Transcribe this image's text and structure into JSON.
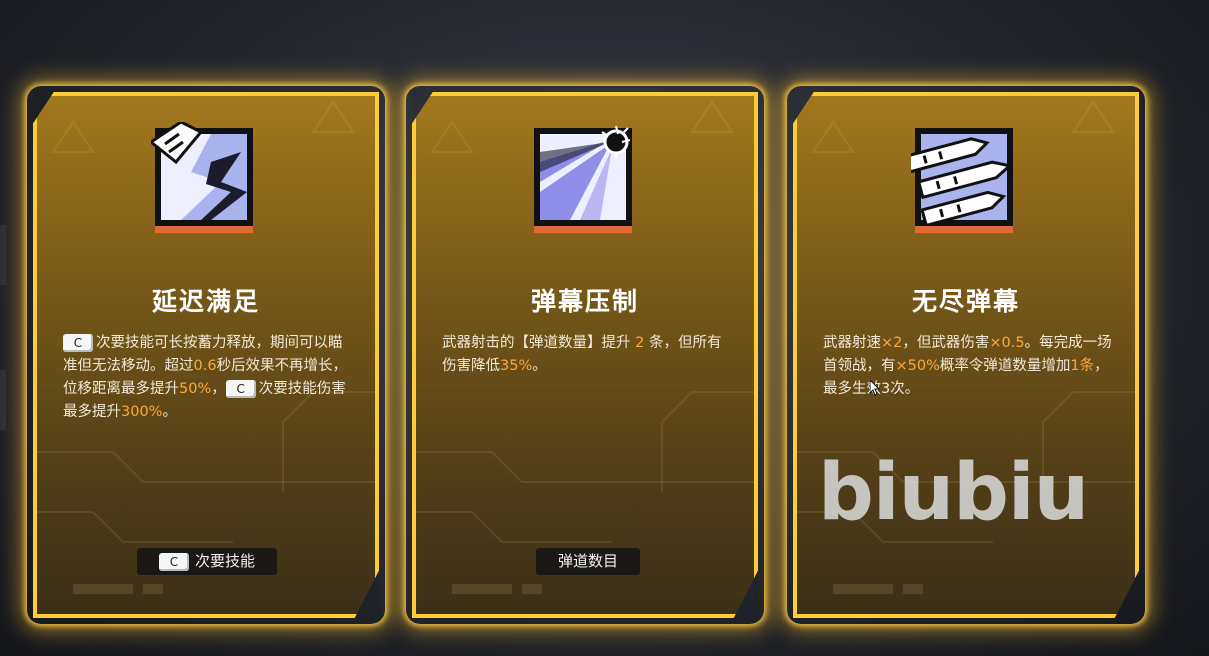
{
  "cards": [
    {
      "title": "延迟满足",
      "key": "C",
      "desc_parts": {
        "p1": "次要技能可长按蓄力释放，期间可以瞄准但无法移动。超过",
        "v1": "0.6",
        "p2": "秒后效果不再增长，位移距离最多提升",
        "v2": "50%",
        "p3": "，",
        "p4": "次要技能伤害最多提升",
        "v3": "300%",
        "p5": "。"
      },
      "tag_key": "C",
      "tag_label": "次要技能"
    },
    {
      "title": "弹幕压制",
      "desc_parts": {
        "p1": "武器射击的【弹道数量】提升 ",
        "v1": "2",
        "p2": " 条，但所有伤害降低",
        "v2": "35%",
        "p3": "。"
      },
      "tag_label": "弹道数目"
    },
    {
      "title": "无尽弹幕",
      "desc_parts": {
        "p1": "武器射速",
        "v1": "×2",
        "p2": "，但武器伤害",
        "v2": "×0.5",
        "p3": "。每完成一场首领战，有",
        "v3": "×50%",
        "p4": "概率令弹道数量增加",
        "v4": "1条",
        "p5": "，最多生效3次。"
      }
    }
  ],
  "watermark": "biubiu",
  "colors": {
    "card_border": "#ffcc35",
    "highlight": "#ffa838",
    "icon_accent": "#e06a35",
    "icon_purple": "#8f8ee8"
  },
  "icons": [
    "dash-strike-icon",
    "barrage-explosion-icon",
    "bullets-icon"
  ]
}
